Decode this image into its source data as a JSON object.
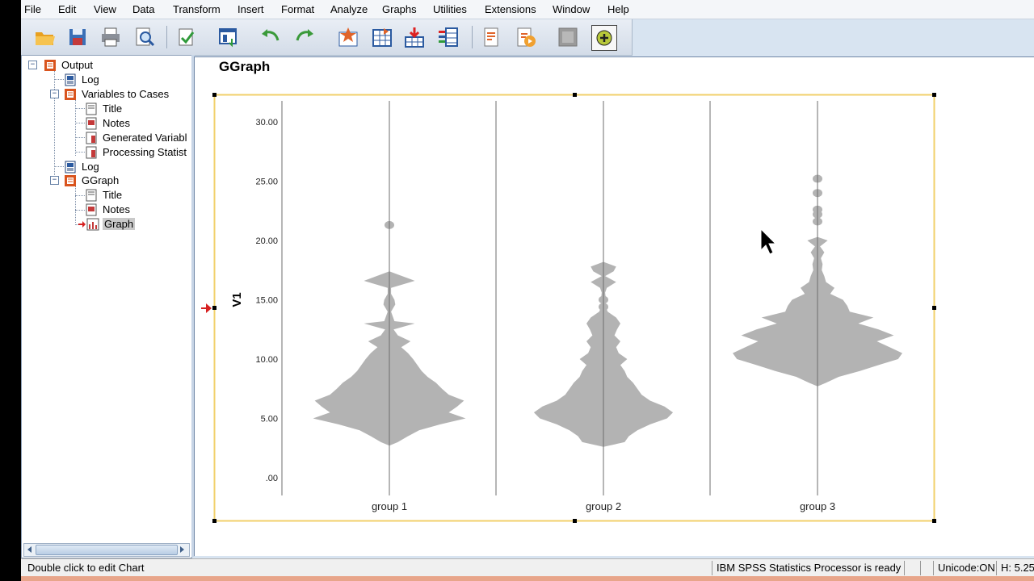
{
  "menu": [
    "File",
    "Edit",
    "View",
    "Data",
    "Transform",
    "Insert",
    "Format",
    "Analyze",
    "Graphs",
    "Utilities",
    "Extensions",
    "Window",
    "Help"
  ],
  "toolbar": {
    "icons": [
      "open-icon",
      "save-icon",
      "print-icon",
      "print-preview-icon",
      "export-icon",
      "goto-data-icon",
      "undo-icon",
      "redo-icon",
      "goto-case-icon",
      "goto-variable-icon",
      "insert-cases-icon",
      "insert-variable-icon",
      "designate-window-icon",
      "script-icon",
      "disabled-icon",
      "add-icon"
    ]
  },
  "tree": {
    "output": "Output",
    "log1": "Log",
    "vtc": "Variables to Cases",
    "vtc_title": "Title",
    "vtc_notes": "Notes",
    "vtc_gen": "Generated Variabl",
    "vtc_proc": "Processing Statist",
    "log2": "Log",
    "ggraph": "GGraph",
    "gg_title": "Title",
    "gg_notes": "Notes",
    "gg_graph": "Graph"
  },
  "content": {
    "title": "GGraph"
  },
  "status": {
    "hint": "Double click to edit Chart",
    "processor": "IBM SPSS Statistics Processor is ready",
    "unicode": "Unicode:ON",
    "dim": "H: 5.25"
  },
  "colors": {
    "violin": "#b3b3b3",
    "frame": "#f2d06b",
    "axis": "#6e6e6e"
  },
  "chart_data": {
    "type": "violin",
    "ylabel": "V1",
    "yticks": [
      ".00",
      "5.00",
      "10.00",
      "15.00",
      "20.00",
      "25.00",
      "30.00"
    ],
    "yvalues": [
      0,
      5,
      10,
      15,
      20,
      25,
      30
    ],
    "ylim": [
      -0.5,
      31.5
    ],
    "categories": [
      "group 1",
      "group 2",
      "group 3"
    ],
    "series": [
      {
        "name": "group 1",
        "profile": [
          [
            2.7,
            0
          ],
          [
            3,
            10
          ],
          [
            3.5,
            22
          ],
          [
            4,
            35
          ],
          [
            4.5,
            60
          ],
          [
            5,
            90
          ],
          [
            5.5,
            70
          ],
          [
            6,
            80
          ],
          [
            6.5,
            88
          ],
          [
            7,
            70
          ],
          [
            7.5,
            62
          ],
          [
            8,
            55
          ],
          [
            8.5,
            45
          ],
          [
            9,
            38
          ],
          [
            9.5,
            33
          ],
          [
            10,
            28
          ],
          [
            10.5,
            22
          ],
          [
            11,
            14
          ],
          [
            11.5,
            25
          ],
          [
            12,
            10
          ],
          [
            12.5,
            5
          ],
          [
            13,
            30
          ],
          [
            13.2,
            6
          ],
          [
            13.6,
            4
          ],
          [
            14,
            2
          ],
          [
            14.6,
            7
          ],
          [
            15,
            6
          ],
          [
            15.5,
            2
          ],
          [
            16,
            2
          ],
          [
            16.6,
            30
          ],
          [
            17,
            15
          ],
          [
            17.4,
            0
          ]
        ],
        "dots": [
          21.3
        ]
      },
      {
        "name": "group 2",
        "profile": [
          [
            2.6,
            0
          ],
          [
            3,
            25
          ],
          [
            3.5,
            30
          ],
          [
            4,
            40
          ],
          [
            4.5,
            55
          ],
          [
            5,
            75
          ],
          [
            5.5,
            82
          ],
          [
            6,
            72
          ],
          [
            6.5,
            55
          ],
          [
            7,
            45
          ],
          [
            7.5,
            40
          ],
          [
            8,
            35
          ],
          [
            8.5,
            28
          ],
          [
            9,
            25
          ],
          [
            9.5,
            20
          ],
          [
            10,
            28
          ],
          [
            10.5,
            18
          ],
          [
            11,
            15
          ],
          [
            11.5,
            20
          ],
          [
            12,
            13
          ],
          [
            12.5,
            16
          ],
          [
            13,
            20
          ],
          [
            13.5,
            15
          ],
          [
            14,
            5
          ],
          [
            14.5,
            2
          ],
          [
            15,
            3
          ],
          [
            15.6,
            2
          ],
          [
            16,
            4
          ],
          [
            16.5,
            15
          ],
          [
            17,
            2
          ],
          [
            17.4,
            12
          ],
          [
            17.8,
            15
          ],
          [
            18.2,
            0
          ]
        ],
        "dots": [
          14.4,
          15.0
        ]
      },
      {
        "name": "group 3",
        "profile": [
          [
            7.7,
            0
          ],
          [
            8,
            10
          ],
          [
            8.5,
            25
          ],
          [
            9,
            50
          ],
          [
            9.5,
            72
          ],
          [
            10,
            95
          ],
          [
            10.5,
            100
          ],
          [
            11,
            85
          ],
          [
            11.5,
            70
          ],
          [
            12,
            90
          ],
          [
            12.5,
            72
          ],
          [
            13,
            48
          ],
          [
            13.5,
            66
          ],
          [
            14,
            38
          ],
          [
            14.5,
            35
          ],
          [
            15,
            30
          ],
          [
            15.5,
            15
          ],
          [
            16,
            20
          ],
          [
            16.5,
            10
          ],
          [
            17,
            8
          ],
          [
            17.5,
            5
          ],
          [
            18,
            6
          ],
          [
            18.5,
            4
          ],
          [
            19,
            8
          ],
          [
            19.5,
            3
          ],
          [
            20,
            12
          ],
          [
            20.3,
            0
          ]
        ],
        "dots": [
          21.6,
          22.2,
          22.6,
          24.0,
          25.2
        ]
      }
    ]
  }
}
